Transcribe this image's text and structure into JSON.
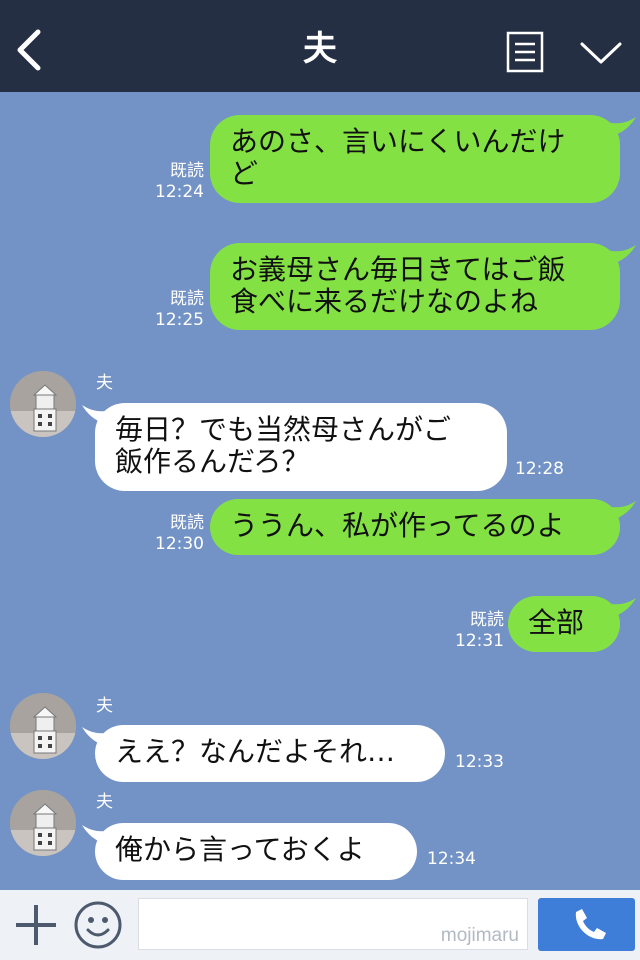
{
  "header": {
    "title": "夫",
    "back_icon": "chevron-left-icon",
    "note_icon": "note-icon",
    "menu_icon": "chevron-down-icon",
    "background": "#252f44"
  },
  "chat_background": "#7393c6",
  "colors": {
    "outgoing_bubble": "#84e143",
    "incoming_bubble": "#ffffff"
  },
  "messages": [
    {
      "side": "out",
      "lines": [
        "あのさ、言いにくいんだけ",
        "ど"
      ],
      "read": "既読",
      "time": "12:24"
    },
    {
      "side": "out",
      "lines": [
        "お義母さん毎日きてはご飯",
        "食べに来るだけなのよね"
      ],
      "read": "既読",
      "time": "12:25"
    },
    {
      "side": "in",
      "sender": "夫",
      "lines": [
        "毎日？でも当然母さんがご",
        "飯作るんだろ？"
      ],
      "time": "12:28"
    },
    {
      "side": "out",
      "lines": [
        "ううん、私が作ってるのよ"
      ],
      "read": "既読",
      "time": "12:30"
    },
    {
      "side": "out",
      "lines": [
        "全部"
      ],
      "read": "既読",
      "time": "12:31"
    },
    {
      "side": "in",
      "sender": "夫",
      "lines": [
        "ええ？なんだよそれ…"
      ],
      "time": "12:33"
    },
    {
      "side": "in",
      "sender": "夫",
      "lines": [
        "俺から言っておくよ"
      ],
      "time": "12:34"
    }
  ],
  "footer": {
    "plus_icon": "plus-icon",
    "emoji_icon": "smiley-icon",
    "input_value": "",
    "watermark": "mojimaru",
    "call_icon": "phone-icon"
  }
}
